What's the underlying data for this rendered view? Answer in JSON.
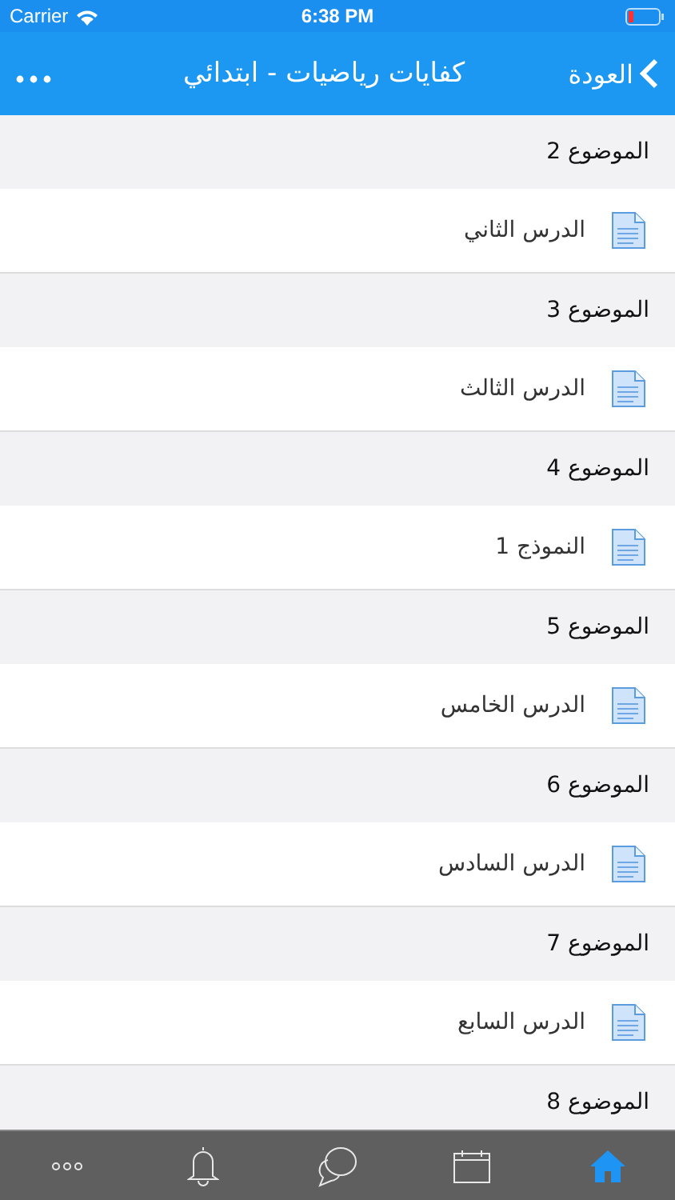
{
  "status_bar": {
    "carrier": "Carrier",
    "time": "6:38 PM"
  },
  "nav_bar": {
    "back": "العودة",
    "title": "كفايات رياضيات - ابتدائي"
  },
  "sections": [
    {
      "title": "الموضوع 2",
      "items": [
        {
          "label": "الدرس الثاني"
        }
      ]
    },
    {
      "title": "الموضوع 3",
      "items": [
        {
          "label": "الدرس الثالث"
        }
      ]
    },
    {
      "title": "الموضوع 4",
      "items": [
        {
          "label": "النموذج 1"
        }
      ]
    },
    {
      "title": "الموضوع 5",
      "items": [
        {
          "label": "الدرس الخامس"
        }
      ]
    },
    {
      "title": "الموضوع 6",
      "items": [
        {
          "label": "الدرس السادس"
        }
      ]
    },
    {
      "title": "الموضوع 7",
      "items": [
        {
          "label": "الدرس السابع"
        }
      ]
    },
    {
      "title": "الموضوع 8"
    }
  ],
  "tab_bar": [
    {
      "kind": "home",
      "selected": true
    },
    {
      "kind": "calendar",
      "selected": false
    },
    {
      "kind": "chat",
      "selected": false
    },
    {
      "kind": "bell",
      "selected": false
    },
    {
      "kind": "more",
      "selected": false
    }
  ]
}
